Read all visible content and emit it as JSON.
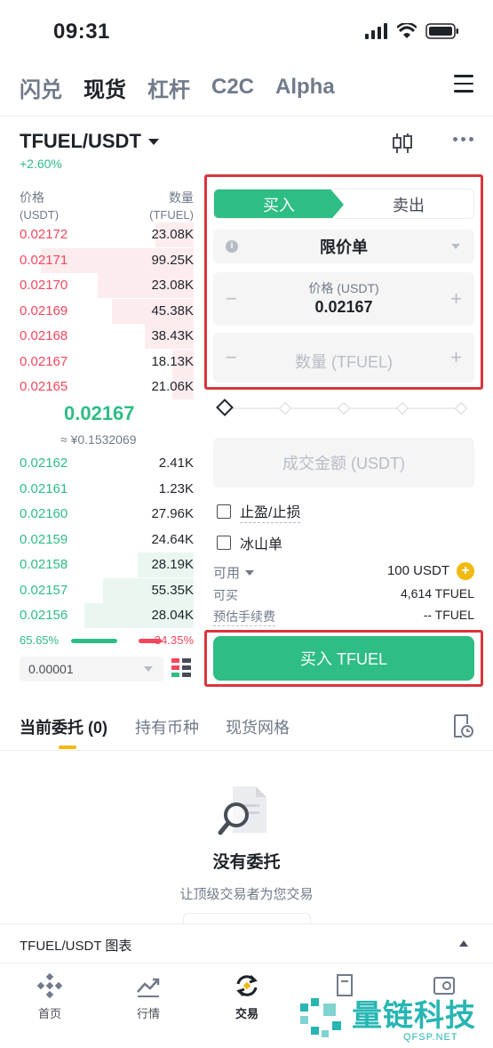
{
  "status_bar": {
    "time": "09:31"
  },
  "top_tabs": [
    "闪兑",
    "现货",
    "杠杆",
    "C2C",
    "Alpha"
  ],
  "pair": {
    "name": "TFUEL/USDT",
    "change": "+2.60%"
  },
  "order_book": {
    "header_price": "价格",
    "header_qty": "数量",
    "unit_price": "(USDT)",
    "unit_qty": "(TFUEL)",
    "asks": [
      {
        "price": "0.02172",
        "qty": "23.08K",
        "depth": 0.22
      },
      {
        "price": "0.02171",
        "qty": "99.25K",
        "depth": 0.88
      },
      {
        "price": "0.02170",
        "qty": "23.08K",
        "depth": 0.55
      },
      {
        "price": "0.02169",
        "qty": "45.38K",
        "depth": 0.47
      },
      {
        "price": "0.02168",
        "qty": "38.43K",
        "depth": 0.28
      },
      {
        "price": "0.02167",
        "qty": "18.13K",
        "depth": 0.12
      },
      {
        "price": "0.02165",
        "qty": "21.06K",
        "depth": 0.12
      }
    ],
    "mid_price": "0.02167",
    "mid_fiat": "≈ ¥0.1532069",
    "bids": [
      {
        "price": "0.02162",
        "qty": "2.41K",
        "depth": 0.0
      },
      {
        "price": "0.02161",
        "qty": "1.23K",
        "depth": 0.0
      },
      {
        "price": "0.02160",
        "qty": "27.96K",
        "depth": 0.0
      },
      {
        "price": "0.02159",
        "qty": "24.64K",
        "depth": 0.0
      },
      {
        "price": "0.02158",
        "qty": "28.19K",
        "depth": 0.32
      },
      {
        "price": "0.02157",
        "qty": "55.35K",
        "depth": 0.52
      },
      {
        "price": "0.02156",
        "qty": "28.04K",
        "depth": 0.63
      }
    ],
    "buy_ratio": "65.65%",
    "sell_ratio": "34.35%",
    "precision": "0.00001"
  },
  "form": {
    "buy_tab": "买入",
    "sell_tab": "卖出",
    "order_type": "限价单",
    "price_label": "价格 (USDT)",
    "price_value": "0.02167",
    "qty_placeholder": "数量 (TFUEL)",
    "amount_placeholder": "成交金额 (USDT)",
    "tp_sl": "止盈/止损",
    "iceberg": "冰山单",
    "available_label": "可用",
    "available_value": "100 USDT",
    "can_buy_label": "可买",
    "can_buy_value": "4,614 TFUEL",
    "fee_label": "预估手续费",
    "fee_value": "-- TFUEL",
    "buy_button": "买入 TFUEL"
  },
  "order_tabs": [
    "当前委托 (0)",
    "持有币种",
    "现货网格"
  ],
  "empty": {
    "title": "没有委托",
    "subtitle": "让顶级交易者为您交易"
  },
  "chart_bar": {
    "label": "TFUEL/USDT 图表"
  },
  "bottom_nav": [
    "首页",
    "行情",
    "交易"
  ],
  "watermark": {
    "text": "量链科技",
    "sub": "QFSP.NET"
  },
  "colors": {
    "green": "#2ebd85",
    "red": "#f6465d",
    "highlight_box": "#d9363e",
    "yellow": "#f0b90b"
  }
}
